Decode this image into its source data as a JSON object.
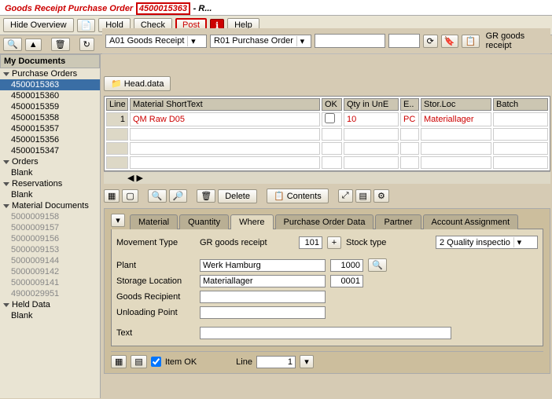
{
  "title": {
    "prefix": "Goods Receipt Purchase Order",
    "doc": "4500015363",
    "suffix": "- R..."
  },
  "toolbar": {
    "hide_overview": "Hide Overview",
    "hold": "Hold",
    "check": "Check",
    "post": "Post",
    "help": "Help"
  },
  "selectors": {
    "goods_receipt": "A01 Goods Receipt",
    "purchase_order": "R01 Purchase Order",
    "gr_label": "GR goods receipt"
  },
  "head_data": "Head.data",
  "grid": {
    "cols": {
      "line": "Line",
      "matshort": "Material ShortText",
      "ok": "OK",
      "qty": "Qty in UnE",
      "e": "E..",
      "storloc": "Stor.Loc",
      "batch": "Batch"
    },
    "rows": [
      {
        "line": "1",
        "matshort": "QM Raw D05",
        "ok": "",
        "qty": "10",
        "e": "PC",
        "storloc": "Materiallager",
        "batch": ""
      }
    ]
  },
  "actions": {
    "delete": "Delete",
    "contents": "Contents"
  },
  "tabs": [
    "Material",
    "Quantity",
    "Where",
    "Purchase Order Data",
    "Partner",
    "Account Assignment"
  ],
  "active_tab": 2,
  "where": {
    "movement_type_label": "Movement Type",
    "movement_type_value": "GR goods receipt",
    "movement_type_code": "101",
    "stock_type_label": "Stock type",
    "stock_type_value": "2 Quality inspectio",
    "plant_label": "Plant",
    "plant_value": "Werk Hamburg",
    "plant_code": "1000",
    "stloc_label": "Storage Location",
    "stloc_value": "Materiallager",
    "stloc_code": "0001",
    "goods_rec_label": "Goods Recipient",
    "unload_label": "Unloading Point",
    "text_label": "Text"
  },
  "footer": {
    "item_ok": "Item OK",
    "line_label": "Line",
    "line_value": "1"
  },
  "sidebar": {
    "my_docs": "My Documents",
    "po": "Purchase Orders",
    "po_items": [
      "4500015363",
      "4500015360",
      "4500015359",
      "4500015358",
      "4500015357",
      "4500015356",
      "4500015347"
    ],
    "orders": "Orders",
    "orders_items": [
      "Blank"
    ],
    "reservations": "Reservations",
    "reservations_items": [
      "Blank"
    ],
    "matdocs": "Material Documents",
    "matdocs_items": [
      "5000009158",
      "5000009157",
      "5000009156",
      "5000009153",
      "5000009144",
      "5000009142",
      "5000009141",
      "4900029951"
    ],
    "held": "Held Data",
    "held_items": [
      "Blank"
    ]
  }
}
